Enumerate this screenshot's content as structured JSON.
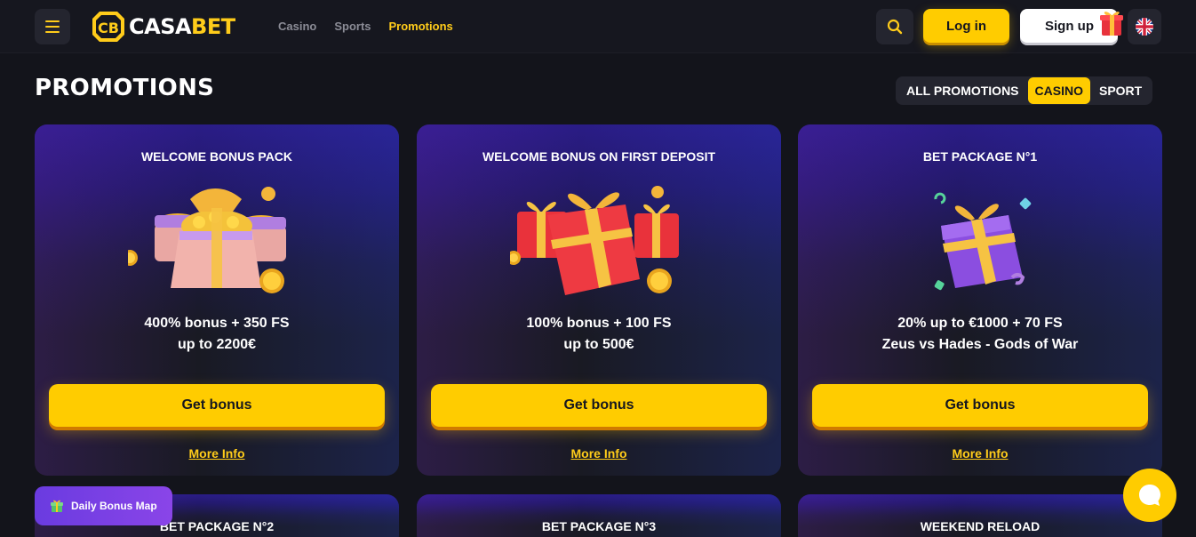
{
  "header": {
    "logo": {
      "badge": "CB",
      "text_white": "CASA",
      "text_yellow": "BET"
    },
    "nav": [
      {
        "label": "Casino",
        "active": false
      },
      {
        "label": "Sports",
        "active": false
      },
      {
        "label": "Promotions",
        "active": true
      }
    ],
    "login_label": "Log in",
    "signup_label": "Sign up",
    "language_icon": "uk-flag-icon"
  },
  "page": {
    "title": "PROMOTIONS",
    "filters": [
      {
        "label": "ALL PROMOTIONS",
        "active": false
      },
      {
        "label": "CASINO",
        "active": true
      },
      {
        "label": "SPORT",
        "active": false
      }
    ]
  },
  "cards": [
    {
      "title": "WELCOME BONUS PACK",
      "icon": "treasure-chests-icon",
      "offer_line1": "400% bonus + 350 FS",
      "offer_line2": "up to 2200€",
      "button": "Get bonus",
      "more": "More Info"
    },
    {
      "title": "WELCOME BONUS ON FIRST DEPOSIT",
      "icon": "red-gift-boxes-icon",
      "offer_line1": "100% bonus + 100 FS",
      "offer_line2": "up to 500€",
      "button": "Get bonus",
      "more": "More Info"
    },
    {
      "title": "BET PACKAGE N°1",
      "icon": "purple-gift-box-icon",
      "offer_line1": "20% up to €1000 + 70 FS",
      "offer_line2": "Zeus vs Hades - Gods of War",
      "button": "Get bonus",
      "more": "More Info"
    },
    {
      "title": "BET PACKAGE N°2"
    },
    {
      "title": "BET PACKAGE N°3"
    },
    {
      "title": "WEEKEND RELOAD"
    }
  ],
  "daily_bonus_label": "Daily Bonus Map",
  "colors": {
    "accent": "#ffcc00",
    "background": "#13141b",
    "card_top": "#2a1c86"
  }
}
